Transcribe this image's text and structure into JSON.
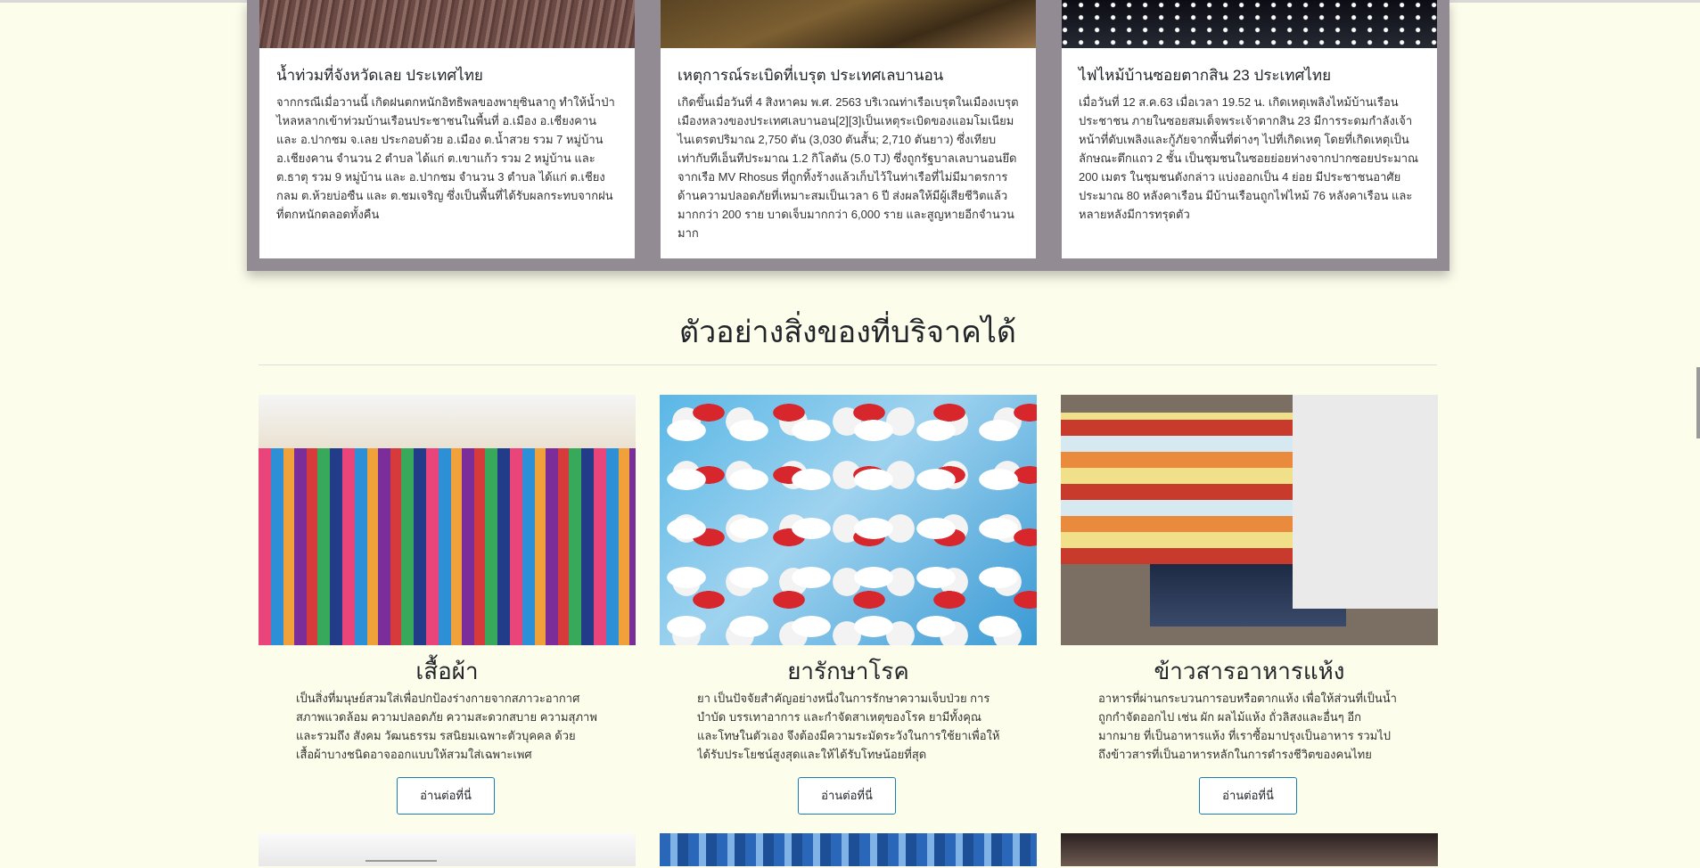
{
  "news": [
    {
      "title": "น้ำท่วมที่จังหวัดเลย ประเทศไทย",
      "body": "จากกรณีเมื่อวานนี้ เกิดฝนตกหนักอิทธิพลของพายุซินลากู ทำให้น้ำป่าไหลหลากเข้าท่วมบ้านเรือนประชาชนในพื้นที่ อ.เมือง อ.เชียงคาน และ อ.ปากชม จ.เลย ประกอบด้วย อ.เมือง ต.น้ำสวย รวม 7 หมู่บ้าน อ.เชียงคาน จำนวน 2 ตำบล ได้แก่ ต.เขาแก้ว รวม 2 หมู่บ้าน และ ต.ธาตุ รวม 9 หมู่บ้าน และ อ.ปากชม จำนวน 3 ตำบล ได้แก่ ต.เชียงกลม ต.ห้วยบ่อซืน และ ต.ชมเจริญ ซึ่งเป็นพื้นที่ได้รับผลกระทบจากฝนที่ตกหนักตลอดทั้งคืน"
    },
    {
      "title": "เหตุการณ์ระเบิดที่เบรุต ประเทศเลบานอน",
      "body": "เกิดขึ้นเมื่อวันที่ 4 สิงหาคม พ.ศ. 2563 บริเวณท่าเรือเบรุตในเมืองเบรุต เมืองหลวงของประเทศเลบานอน[2][3]เป็นเหตุระเบิดของแอมโมเนียมไนเตรตปริมาณ 2,750 ตัน (3,030 ตันสั้น; 2,710 ตันยาว) ซึ่งเทียบเท่ากับทีเอ็นทีประมาณ 1.2 กิโลตัน (5.0 TJ) ซึ่งถูกรัฐบาลเลบานอนยึดจากเรือ MV Rhosus ที่ถูกทิ้งร้างแล้วเก็บไว้ในท่าเรือที่ไม่มีมาตรการด้านความปลอดภัยที่เหมาะสมเป็นเวลา 6 ปี ส่งผลให้มีผู้เสียชีวิตแล้วมากกว่า 200 ราย บาดเจ็บมากกว่า 6,000 ราย และสูญหายอีกจำนวนมาก"
    },
    {
      "title": "ไฟไหม้บ้านซอยตากสิน 23 ประเทศไทย",
      "body": "เมื่อวันที่ 12 ส.ค.63 เมื่อเวลา 19.52 น. เกิดเหตุเพลิงไหม้บ้านเรือนประชาชน ภายในซอยสมเด็จพระเจ้าตากสิน 23 มีการระดมกำลังเจ้าหน้าที่ดับเพลิงและกู้ภัยจากพื้นที่ต่างๆ ไปที่เกิดเหตุ โดยที่เกิดเหตุเป็นลักษณะตึกแถว 2 ชั้น เป็นชุมชนในซอยย่อยห่างจากปากซอยประมาณ 200 เมตร ในชุมชนดังกล่าว แบ่งออกเป็น 4 ย่อย มีประชาชนอาศัยประมาณ 80 หลังคาเรือน มีบ้านเรือนถูกไฟไหม้ 76 หลังคาเรือน และหลายหลังมีการทรุดตัว"
    }
  ],
  "section": {
    "title": "ตัวอย่างสิ่งของที่บริจาคได้"
  },
  "donations": [
    {
      "title": "เสื้อผ้า",
      "text": "เป็นสิ่งที่มนุษย์สวมใส่เพื่อปกป้องร่างกายจากสภาวะอากาศ สภาพแวดล้อม ความปลอดภัย ความสะดวกสบาย ความสุภาพ และรวมถึง สังคม วัฒนธรรม รสนิยมเฉพาะตัวบุคคล ด้วย เสื้อผ้าบางชนิดอาจออกแบบให้สวมใส่เฉพาะเพศ",
      "button": "อ่านต่อที่นี่"
    },
    {
      "title": "ยารักษาโรค",
      "text": "ยา เป็นปัจจัยสำคัญอย่างหนึ่งในการรักษาความเจ็บป่วย การบำบัด บรรเทาอาการ และกำจัดสาเหตุของโรค ยามีทั้งคุณและโทษในตัวเอง จึงต้องมีความระมัดระวังในการใช้ยาเพื่อให้ได้รับประโยชน์สูงสุดและให้ได้รับโทษน้อยที่สุด",
      "button": "อ่านต่อที่นี่"
    },
    {
      "title": "ข้าวสารอาหารแห้ง",
      "text": "อาหารที่ผ่านกระบวนการอบหรือตากแห้ง เพื่อให้ส่วนที่เป็นน้ำถูกกำจัดออกไป เช่น ผัก ผลไม้แห้ง ถั่วลิสงและอื่นๆ อีกมากมาย ที่เป็นอาหารแห้ง ที่เราซื้อมาปรุงเป็นอาหาร รวมไปถึงข้าวสารที่เป็นอาหารหลักในการดำรงชีวิตของคนไทย",
      "button": "อ่านต่อที่นี่"
    }
  ]
}
